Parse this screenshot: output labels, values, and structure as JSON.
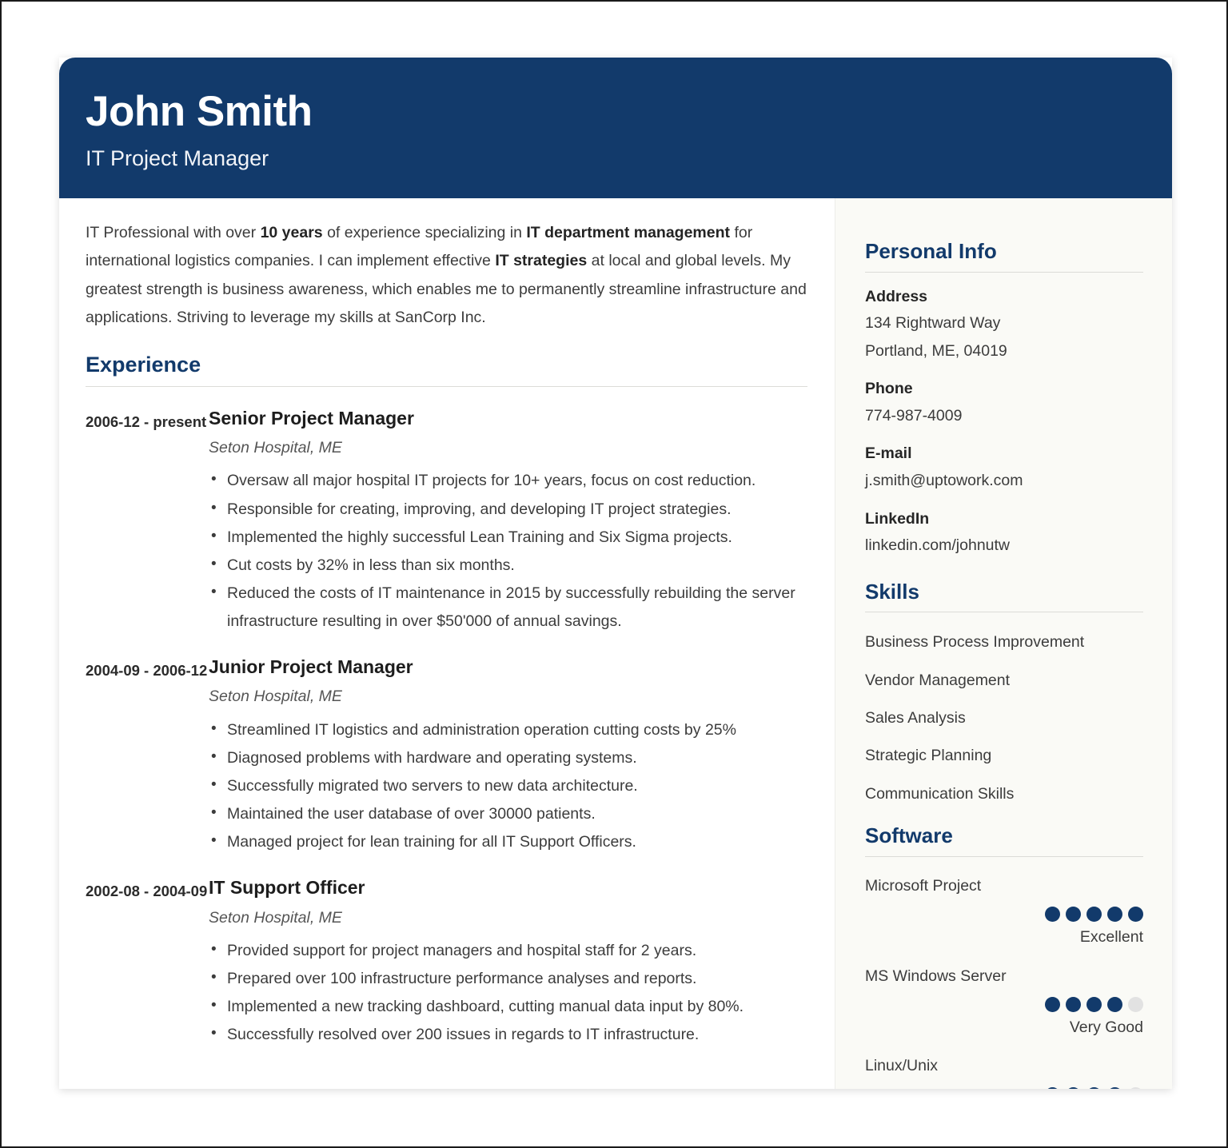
{
  "colors": {
    "accent_navy": "#123A6B",
    "header_bg": "#123A6B",
    "sidebar_bg": "#FAFAF6",
    "dot_filled": "#123A6B",
    "dot_empty": "#E2E2E2",
    "body_text": "#3C3C3C"
  },
  "header": {
    "name": "John Smith",
    "title": "IT Project Manager"
  },
  "summary": {
    "part1": "IT Professional with over ",
    "bold1": "10 years",
    "part2": " of experience specializing in ",
    "bold2": "IT department management",
    "part3": " for international logistics companies. I can implement effective ",
    "bold3": "IT strategies",
    "part4": " at local and global levels. My greatest strength is business awareness, which enables me to permanently streamline infrastructure and applications. Striving to leverage my skills at SanCorp Inc."
  },
  "experience": {
    "heading": "Experience",
    "jobs": [
      {
        "dates": "2006-12 - present",
        "role": "Senior Project Manager",
        "company": "Seton Hospital, ME",
        "bullets": [
          "Oversaw all major hospital IT projects for 10+ years, focus on cost reduction.",
          "Responsible for creating, improving, and developing IT project strategies.",
          "Implemented the highly successful Lean Training and Six Sigma projects.",
          "Cut costs by 32% in less than six months.",
          "Reduced the costs of IT maintenance in 2015 by successfully rebuilding the server infrastructure resulting in over $50'000 of annual savings."
        ]
      },
      {
        "dates": "2004-09 - 2006-12",
        "role": "Junior Project Manager",
        "company": "Seton Hospital, ME",
        "bullets": [
          "Streamlined IT logistics and administration operation cutting costs by 25%",
          "Diagnosed problems with hardware and operating systems.",
          "Successfully migrated two servers to new data architecture.",
          "Maintained the user database of over 30000 patients.",
          "Managed project for lean training for all IT Support Officers."
        ]
      },
      {
        "dates": "2002-08 - 2004-09",
        "role": "IT Support Officer",
        "company": "Seton Hospital, ME",
        "bullets": [
          "Provided support for project managers and hospital staff for 2 years.",
          "Prepared over 100 infrastructure performance analyses and reports.",
          "Implemented a new tracking dashboard, cutting manual data input by 80%.",
          "Successfully resolved over 200 issues in regards to IT infrastructure."
        ]
      }
    ]
  },
  "personal_info": {
    "heading": "Personal Info",
    "address_label": "Address",
    "address_line1": "134 Rightward Way",
    "address_line2": "Portland, ME, 04019",
    "phone_label": "Phone",
    "phone_value": "774-987-4009",
    "email_label": "E-mail",
    "email_value": "j.smith@uptowork.com",
    "linkedin_label": "LinkedIn",
    "linkedin_value": "linkedin.com/johnutw"
  },
  "skills": {
    "heading": "Skills",
    "items": [
      "Business Process Improvement",
      "Vendor Management",
      "Sales Analysis",
      "Strategic Planning",
      "Communication Skills"
    ]
  },
  "software": {
    "heading": "Software",
    "max_dots": 5,
    "items": [
      {
        "name": "Microsoft Project",
        "rating": 5,
        "level": "Excellent"
      },
      {
        "name": "MS Windows Server",
        "rating": 4,
        "level": "Very Good"
      },
      {
        "name": "Linux/Unix",
        "rating": 4,
        "level": ""
      }
    ]
  }
}
